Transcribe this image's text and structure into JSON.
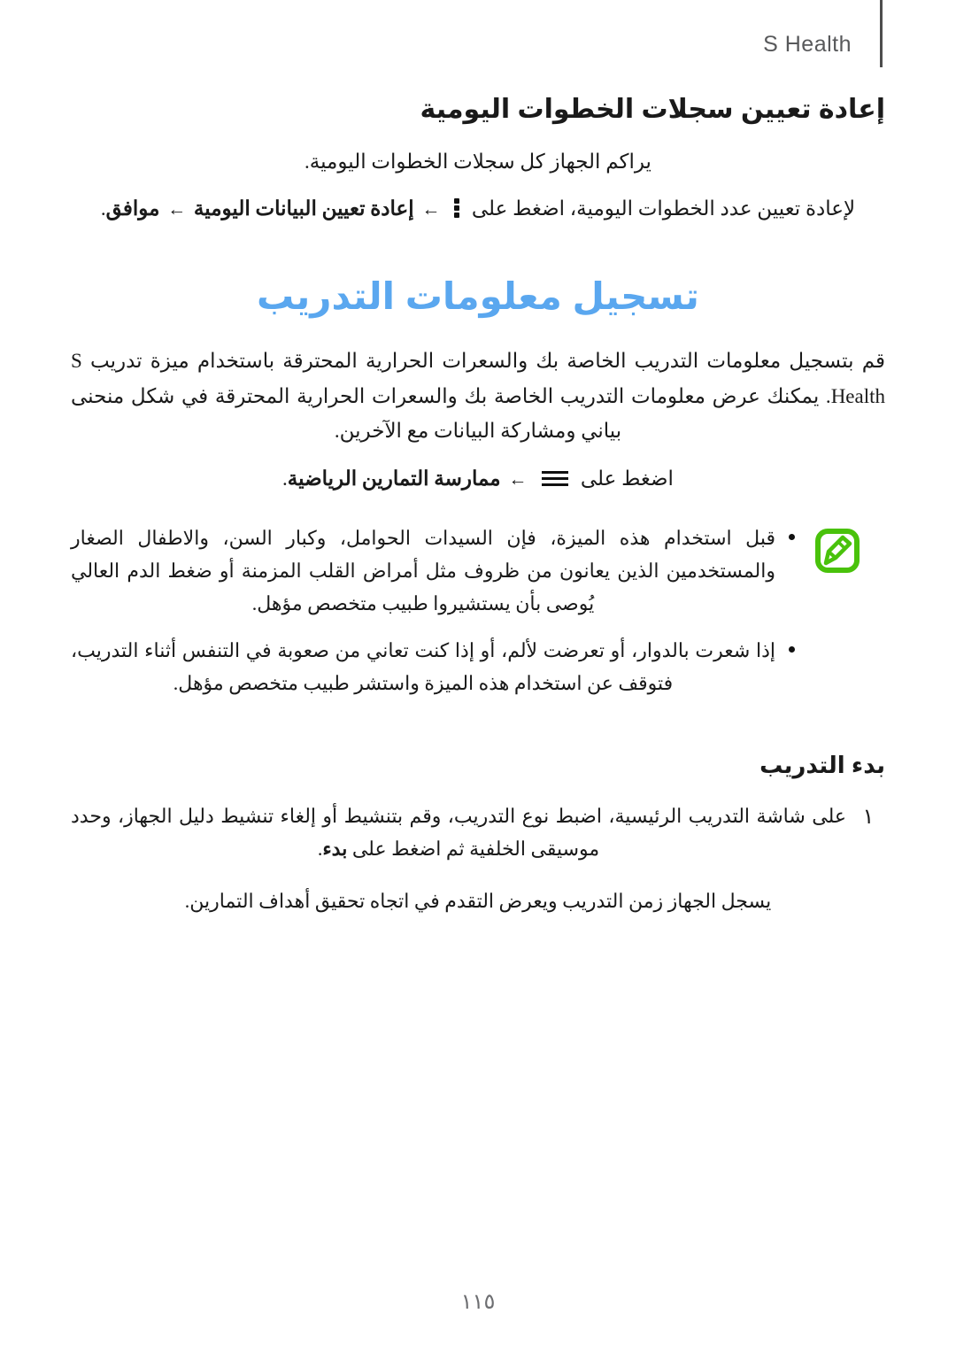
{
  "document": {
    "language": "ar",
    "direction": "rtl",
    "accent_color": "#5aa7ef",
    "note_icon_color": "#49c20b",
    "header_text_color": "#58595b"
  },
  "header": {
    "title": "S Health",
    "rule_icon": "vertical-rule"
  },
  "section_reset": {
    "heading": "إعادة تعيين سجلات الخطوات اليومية",
    "paragraph": "يراكم الجهاز كل سجلات الخطوات اليومية.",
    "instruction": {
      "lead": "لإعادة تعيين عدد الخطوات اليومية، اضغط على",
      "dots_icon": "more-options-icon",
      "arrow_1": "←",
      "menu_item_1": "إعادة تعيين البيانات اليومية",
      "arrow_2": "←",
      "menu_item_2": "موافق",
      "trailing": "."
    }
  },
  "section_training": {
    "heading": "تسجيل معلومات التدريب",
    "paragraph": "قم بتسجيل معلومات التدريب الخاصة بك والسعرات الحرارية المحترقة باستخدام ميزة تدريب S Health. يمكنك عرض معلومات التدريب الخاصة بك والسعرات الحرارية المحترقة في شكل منحنى بياني ومشاركة البيانات مع الآخرين.",
    "instruction": {
      "lead": "اضغط على",
      "menu_icon": "hamburger-menu-icon",
      "arrow": "←",
      "menu_item": "ممارسة التمارين الرياضية",
      "trailing": "."
    },
    "note": {
      "icon": "note-pencil-icon",
      "items": [
        "قبل استخدام هذه الميزة، فإن السيدات الحوامل، وكبار السن، والاطفال الصغار والمستخدمين الذين يعانون من ظروف مثل أمراض القلب المزمنة أو ضغط الدم العالي يُوصى بأن يستشيروا طبيب متخصص مؤهل.",
        "إذا شعرت بالدوار، أو تعرضت لألم، أو إذا كنت تعاني من صعوبة في التنفس أثناء التدريب، فتوقف عن استخدام هذه الميزة واستشر طبيب متخصص مؤهل."
      ]
    }
  },
  "section_start_training": {
    "heading": "بدء التدريب",
    "steps": [
      {
        "number": "١",
        "text_before_bold": "على شاشة التدريب الرئيسية، اضبط نوع التدريب، وقم بتنشيط أو إلغاء تنشيط دليل الجهاز، وحدد موسيقى الخلفية ثم اضغط على",
        "bold": "بدء",
        "text_after_bold": "."
      }
    ],
    "follow_up": "يسجل الجهاز زمن التدريب ويعرض التقدم في اتجاه تحقيق أهداف التمارين."
  },
  "footer": {
    "page_number": "١١٥"
  }
}
